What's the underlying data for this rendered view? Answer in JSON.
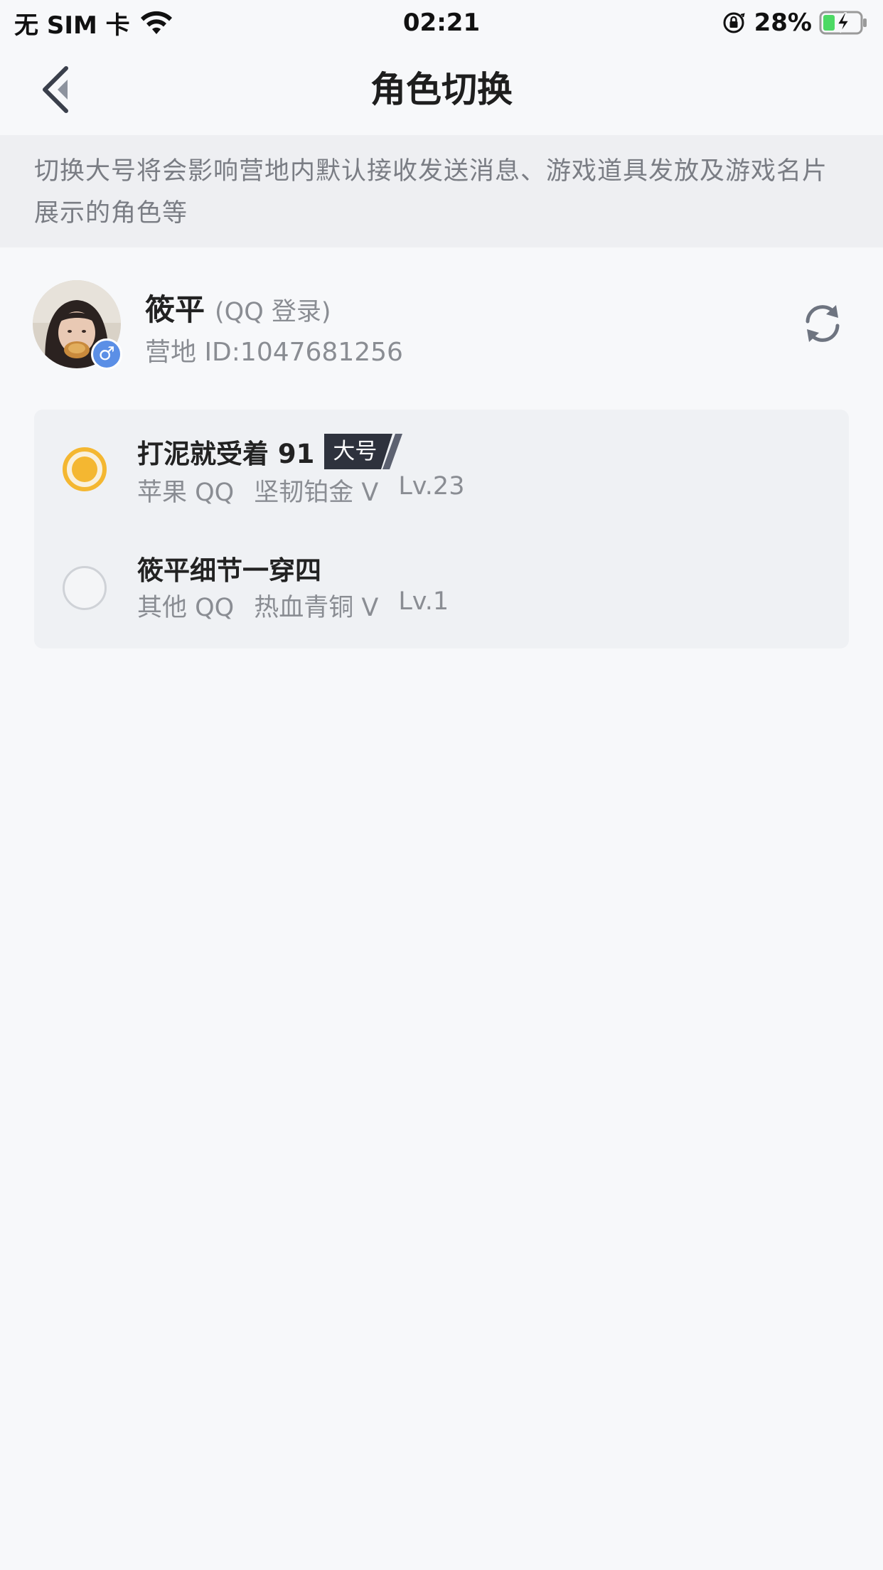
{
  "status_bar": {
    "carrier": "无 SIM 卡",
    "time": "02:21",
    "battery": "28%"
  },
  "nav": {
    "title": "角色切换"
  },
  "notice": {
    "line1": "切换大号将会影响营地内默认接收发送消息、游戏道具发放及游戏名片",
    "line2": "展示的角色等"
  },
  "profile": {
    "name": "筱平",
    "login_type": "(QQ 登录)",
    "camp_id": "营地 ID:1047681256",
    "gender_symbol": "♂"
  },
  "roles": [
    {
      "name": "打泥就受着 91",
      "badge": "大号",
      "platform": "苹果 QQ",
      "rank": "坚韧铂金 V",
      "level": "Lv.23",
      "selected": true
    },
    {
      "name": "筱平细节一穿四",
      "badge": "",
      "platform": "其他 QQ",
      "rank": "热血青铜 V",
      "level": "Lv.1",
      "selected": false
    }
  ],
  "colors": {
    "accent": "#f4b731",
    "background": "#f7f8fa",
    "notice_bg": "#eeeff2",
    "card_bg": "#eff1f4",
    "muted_text": "#8a8d93",
    "badge_bg": "#2e323d"
  }
}
